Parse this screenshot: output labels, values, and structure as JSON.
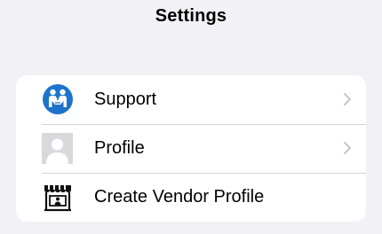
{
  "header": {
    "title": "Settings"
  },
  "settings": {
    "items": [
      {
        "label": "Support",
        "icon": "support-icon",
        "has_chevron": true
      },
      {
        "label": "Profile",
        "icon": "profile-avatar-icon",
        "has_chevron": true
      },
      {
        "label": "Create Vendor Profile",
        "icon": "storefront-icon",
        "has_chevron": false
      }
    ]
  },
  "colors": {
    "background": "#f2f2f6",
    "card": "#ffffff",
    "accent_blue": "#1d73c9",
    "chevron": "#c4c4c8",
    "separator": "#d6d6da"
  }
}
